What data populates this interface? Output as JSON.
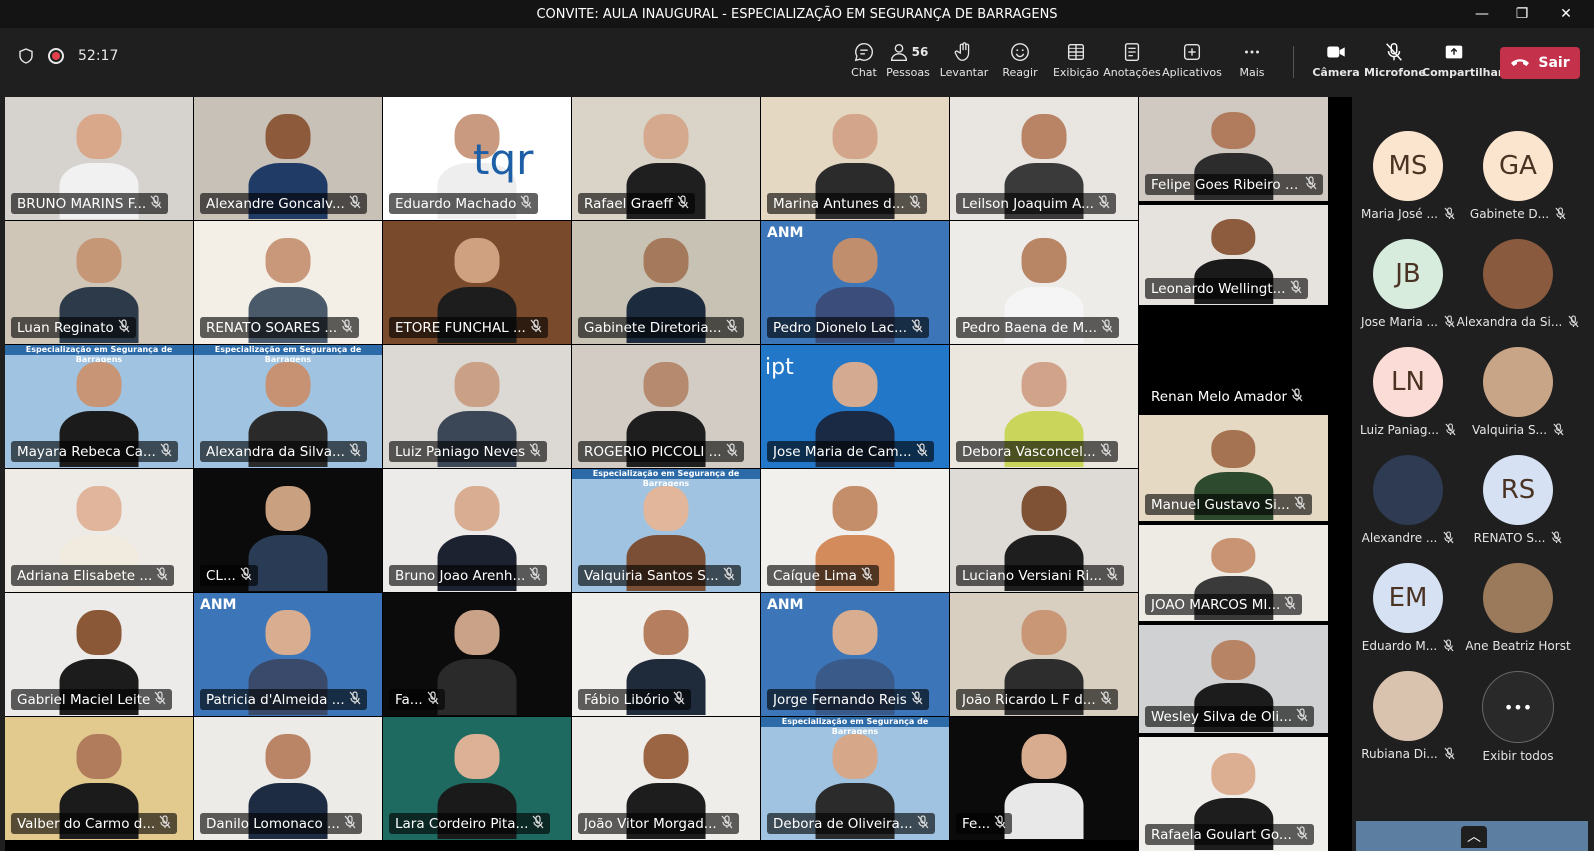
{
  "window": {
    "title": "CONVITE: AULA INAUGURAL - ESPECIALIZAÇÃO EM SEGURANÇA DE BARRAGENS"
  },
  "meeting": {
    "timer": "52:17"
  },
  "toolbar": {
    "chat": "Chat",
    "people": "Pessoas",
    "people_count": "56",
    "raise": "Levantar",
    "react": "Reagir",
    "view": "Exibição",
    "notes": "Anotações",
    "apps": "Aplicativos",
    "more": "Mais",
    "camera": "Câmera",
    "mic": "Microfone",
    "share": "Compartilhar",
    "leave": "Sair"
  },
  "tiles": [
    {
      "name": "BRUNO MARINS F...",
      "bg": "#d6d3cf",
      "skin": "#d9a88a",
      "shirt": "#f1f1f1"
    },
    {
      "name": "Alexandre Goncalv...",
      "bg": "#c7c1b8",
      "skin": "#8e5a3c",
      "shirt": "#203b66"
    },
    {
      "name": "Eduardo Machado",
      "bg": "#ffffff",
      "skin": "#c99a7f",
      "shirt": "#eeeeee",
      "logo": "tqr"
    },
    {
      "name": "Rafael Graeff",
      "bg": "#d9d3c8",
      "skin": "#d4a98d",
      "shirt": "#1f1f1f"
    },
    {
      "name": "Marina Antunes d...",
      "bg": "#e5d8c2",
      "skin": "#d3a58a",
      "shirt": "#2b2b2b"
    },
    {
      "name": "Leilson Joaquim A...",
      "bg": "#e9e6e2",
      "skin": "#b98466",
      "shirt": "#3a3a3a"
    },
    {
      "name": "Felipe Goes Ribeiro B...",
      "bg": "#cfc9c2",
      "skin": "#b07c5d",
      "shirt": "#2c2c2c"
    },
    {
      "name": "Luan Reginato",
      "bg": "#cfc6b8",
      "skin": "#c69776",
      "shirt": "#2d3a4a"
    },
    {
      "name": "RENATO SOARES ...",
      "bg": "#f3efe6",
      "skin": "#c9977a",
      "shirt": "#4a5a6a"
    },
    {
      "name": "ETORE FUNCHAL ...",
      "bg": "#7a4a2c",
      "skin": "#d0a180",
      "shirt": "#1d1d1d"
    },
    {
      "name": "Gabinete Diretoria...",
      "bg": "#c8c2b5",
      "skin": "#a57a5c",
      "shirt": "#1c2b3d"
    },
    {
      "name": "Pedro Dionelo Lac...",
      "bg": "#3d76b8",
      "skin": "#c08e6c",
      "shirt": "#3b4d7a",
      "logo": "ANM"
    },
    {
      "name": "Pedro Baena de M...",
      "bg": "#eeece8",
      "skin": "#b88565",
      "shirt": "#f5f5f5"
    },
    {
      "name": "Leonardo Wellingt...",
      "bg": "#e6e3df",
      "skin": "#8d5b3d",
      "shirt": "#1a1a1a"
    },
    {
      "name": "Mayara Rebeca Ca...",
      "bg": "#9fc3e0",
      "skin": "#c99577",
      "shirt": "#1b1b1b",
      "logo": "banner"
    },
    {
      "name": "Alexandra da Silva...",
      "bg": "#9fc3e0",
      "skin": "#c79273",
      "shirt": "#2a2a2a",
      "logo": "banner"
    },
    {
      "name": "Luiz Paniago Neves",
      "bg": "#dcd8d3",
      "skin": "#caa087",
      "shirt": "#3b4657"
    },
    {
      "name": "ROGERIO PICCOLI ...",
      "bg": "#d2ccc4",
      "skin": "#b58a6e",
      "shirt": "#1e1e1e"
    },
    {
      "name": "Jose Maria de Cam...",
      "bg": "#2277c9",
      "skin": "#d4ab90",
      "shirt": "#1a2a44",
      "logo": "ipt"
    },
    {
      "name": "Debora Vasconcel...",
      "bg": "#ece7de",
      "skin": "#d1a38a",
      "shirt": "#c9d65b"
    },
    {
      "name": "Renan Melo Amador",
      "bg": "#000000",
      "skin": "#000000",
      "shirt": "#000000",
      "empty": true
    },
    {
      "name": "Adriana Elisabete ...",
      "bg": "#eeebe7",
      "skin": "#e0b59b",
      "shirt": "#f0eadf"
    },
    {
      "name": "CL...",
      "bg": "#0b0b0b",
      "skin": "#c9a080",
      "shirt": "#2a3b55"
    },
    {
      "name": "Bruno Joao Arenh...",
      "bg": "#ecebea",
      "skin": "#d8ad92",
      "shirt": "#1d2230"
    },
    {
      "name": "Valquiria Santos S...",
      "bg": "#9fc3e0",
      "skin": "#e1b69b",
      "shirt": "#7b4f35",
      "logo": "banner"
    },
    {
      "name": "Caíque Lima",
      "bg": "#f2f0ec",
      "skin": "#c48e6b",
      "shirt": "#d48b5c"
    },
    {
      "name": "Luciano Versiani Ri...",
      "bg": "#dedbd6",
      "skin": "#7f5236",
      "shirt": "#1e1e1e"
    },
    {
      "name": "Manuel Gustavo Si...",
      "bg": "#e6d9c4",
      "skin": "#a57352",
      "shirt": "#2e4a2e"
    },
    {
      "name": "Gabriel Maciel Leite",
      "bg": "#ecebe9",
      "skin": "#8a5837",
      "shirt": "#1c1c1c"
    },
    {
      "name": "Patricia d'Almeida ...",
      "bg": "#3d76b8",
      "skin": "#d9ad90",
      "shirt": "#3a4a6a",
      "logo": "ANM"
    },
    {
      "name": "Fa...",
      "bg": "#0b0b0b",
      "skin": "#caa287",
      "shirt": "#2a2a2a"
    },
    {
      "name": "Fábio Libório",
      "bg": "#f1efeb",
      "skin": "#b57f5f",
      "shirt": "#1f2a3a"
    },
    {
      "name": "Jorge Fernando Reis",
      "bg": "#3d76b8",
      "skin": "#d9ad90",
      "shirt": "#3a5a8a",
      "logo": "ANM"
    },
    {
      "name": "João Ricardo L F d...",
      "bg": "#d9cfc0",
      "skin": "#c99676",
      "shirt": "#2d2d2d"
    },
    {
      "name": "JOAO MARCOS MI...",
      "bg": "#eeeae4",
      "skin": "#c99473",
      "shirt": "#3a3a3a"
    },
    {
      "name": "Valber do Carmo d...",
      "bg": "#e2c98e",
      "skin": "#b07c5c",
      "shirt": "#1b1b1b"
    },
    {
      "name": "Danilo Lomonaco ...",
      "bg": "#ecebe8",
      "skin": "#b98566",
      "shirt": "#1d2c42"
    },
    {
      "name": "Lara Cordeiro Pita...",
      "bg": "#1f6a60",
      "skin": "#dcb195",
      "shirt": "#1a1a1a"
    },
    {
      "name": "João Vitor Morgad...",
      "bg": "#efede9",
      "skin": "#9b6443",
      "shirt": "#1d1d1d"
    },
    {
      "name": "Debora de Oliveira...",
      "bg": "#9fc3e0",
      "skin": "#d6a788",
      "shirt": "#2b2b2b",
      "logo": "banner"
    },
    {
      "name": "Fe...",
      "bg": "#0b0b0b",
      "skin": "#d8ac8e",
      "shirt": "#e8e8e8"
    },
    {
      "name": "Wesley Silva de Oli...",
      "bg": "#cfd1d2",
      "skin": "#b78465",
      "shirt": "#1c1c1c"
    },
    {
      "name": "Rafaela Goulart Go...",
      "bg": "#f0eeea",
      "skin": "#dcae92",
      "shirt": "#1d1d1d"
    }
  ],
  "banner_text": "Especialização em Segurança de Barragens",
  "logos": {
    "tqr": "tqr",
    "anm": "ANM",
    "ipt": "ipt"
  },
  "panel": [
    {
      "initials": "MS",
      "name": "Maria José ...",
      "color": "#fbe5cf"
    },
    {
      "initials": "GA",
      "name": "Gabinete D...",
      "color": "#fbe5cf"
    },
    {
      "initials": "JB",
      "name": "Jose Maria ...",
      "color": "#d7ecdd"
    },
    {
      "initials": "",
      "name": "Alexandra da Si...",
      "color": "#8a5a3e"
    },
    {
      "initials": "LN",
      "name": "Luiz Paniag...",
      "color": "#fcdcd6"
    },
    {
      "initials": "",
      "name": "Valquiria S...",
      "color": "#c9a587"
    },
    {
      "initials": "",
      "name": "Alexandre ...",
      "color": "#2e3b52"
    },
    {
      "initials": "RS",
      "name": "RENATO S...",
      "color": "#d6e2f3"
    },
    {
      "initials": "EM",
      "name": "Eduardo M...",
      "color": "#d6e2f3"
    },
    {
      "initials": "",
      "name": "Ane Beatriz Horst",
      "color": "#9a7a5a"
    },
    {
      "initials": "",
      "name": "Rubiana Di...",
      "color": "#d9c2ae"
    },
    {
      "initials": "•••",
      "name": "Exibir todos",
      "color": "#292929"
    }
  ]
}
